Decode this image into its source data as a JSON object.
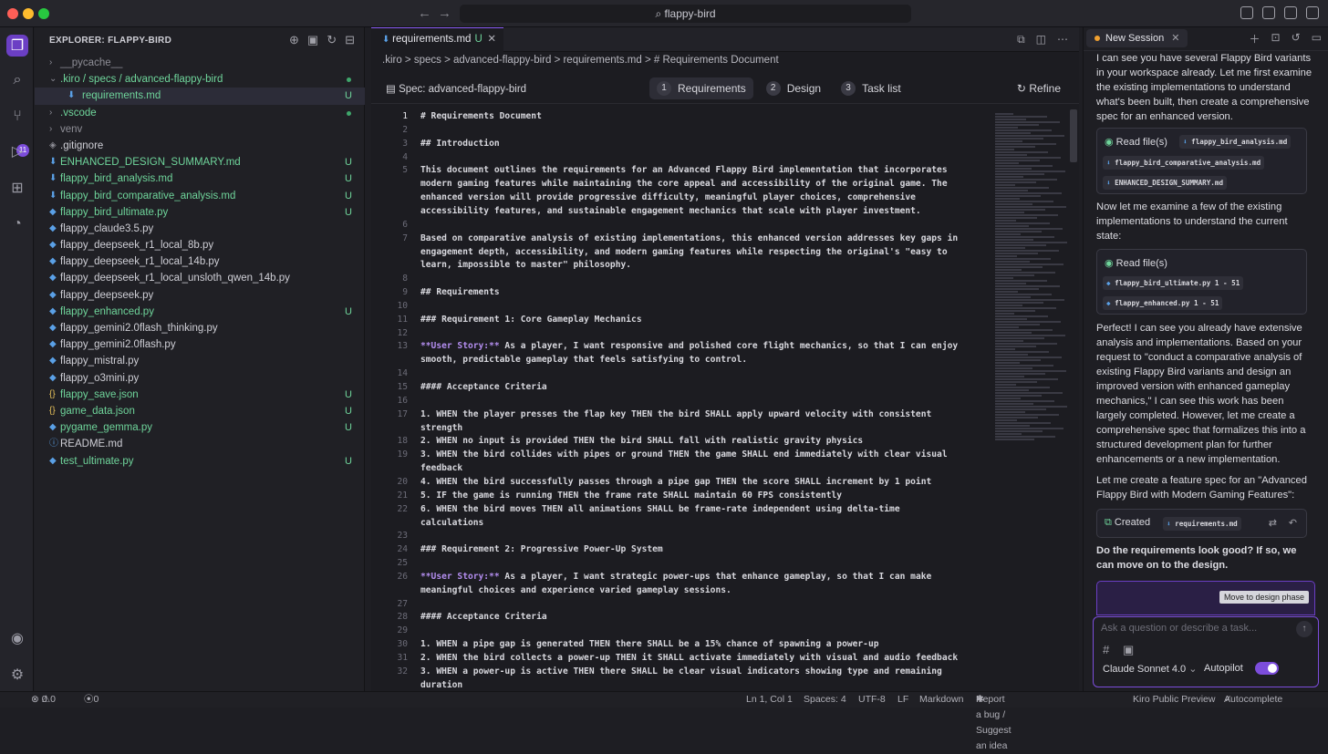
{
  "titlebar": {
    "search": "flappy-bird"
  },
  "explorer": {
    "title": "EXPLORER: FLAPPY-BIRD",
    "items": [
      {
        "name": "__pycache__",
        "chev": ">",
        "status": "",
        "color": "gray"
      },
      {
        "name": ".kiro / specs / advanced-flappy-bird",
        "chev": "v",
        "status": "dot",
        "color": "green"
      },
      {
        "name": "requirements.md",
        "status": "U",
        "color": "green"
      },
      {
        "name": ".vscode",
        "chev": ">",
        "status": "dot",
        "color": "green"
      },
      {
        "name": "venv",
        "chev": ">",
        "status": "",
        "color": "gray"
      },
      {
        "name": ".gitignore",
        "status": "",
        "color": "norm"
      },
      {
        "name": "ENHANCED_DESIGN_SUMMARY.md",
        "status": "U",
        "color": "green"
      },
      {
        "name": "flappy_bird_analysis.md",
        "status": "U",
        "color": "green"
      },
      {
        "name": "flappy_bird_comparative_analysis.md",
        "status": "U",
        "color": "green"
      },
      {
        "name": "flappy_bird_ultimate.py",
        "status": "U",
        "color": "green"
      },
      {
        "name": "flappy_claude3.5.py",
        "status": "",
        "color": "norm"
      },
      {
        "name": "flappy_deepseek_r1_local_8b.py",
        "status": "",
        "color": "norm"
      },
      {
        "name": "flappy_deepseek_r1_local_14b.py",
        "status": "",
        "color": "norm"
      },
      {
        "name": "flappy_deepseek_r1_local_unsloth_qwen_14b.py",
        "status": "",
        "color": "norm"
      },
      {
        "name": "flappy_deepseek.py",
        "status": "",
        "color": "norm"
      },
      {
        "name": "flappy_enhanced.py",
        "status": "U",
        "color": "green"
      },
      {
        "name": "flappy_gemini2.0flash_thinking.py",
        "status": "",
        "color": "norm"
      },
      {
        "name": "flappy_gemini2.0flash.py",
        "status": "",
        "color": "norm"
      },
      {
        "name": "flappy_mistral.py",
        "status": "",
        "color": "norm"
      },
      {
        "name": "flappy_o3mini.py",
        "status": "",
        "color": "norm"
      },
      {
        "name": "flappy_save.json",
        "status": "U",
        "color": "green"
      },
      {
        "name": "game_data.json",
        "status": "U",
        "color": "green"
      },
      {
        "name": "pygame_gemma.py",
        "status": "U",
        "color": "green"
      },
      {
        "name": "README.md",
        "status": "",
        "color": "norm"
      },
      {
        "name": "test_ultimate.py",
        "status": "U",
        "color": "green"
      }
    ]
  },
  "editor": {
    "tab_label": "requirements.md",
    "tab_status": "U",
    "breadcrumb": ".kiro  >  specs  >  advanced-flappy-bird  >  requirements.md  >  # Requirements Document",
    "spec_title": "Spec: advanced-flappy-bird",
    "steps": [
      {
        "n": "1",
        "label": "Requirements"
      },
      {
        "n": "2",
        "label": "Design"
      },
      {
        "n": "3",
        "label": "Task list"
      }
    ],
    "refine": "Refine",
    "lines": [
      {
        "num": "1",
        "text": "# Requirements Document"
      },
      {
        "num": "2",
        "text": ""
      },
      {
        "num": "3",
        "text": "## Introduction"
      },
      {
        "num": "4",
        "text": ""
      },
      {
        "num": "5",
        "text": "This document outlines the requirements for an Advanced Flappy Bird implementation that incorporates"
      },
      {
        "num": "",
        "text": "modern gaming features while maintaining the core appeal and accessibility of the original game. The"
      },
      {
        "num": "",
        "text": "enhanced version will provide progressive difficulty, meaningful player choices, comprehensive"
      },
      {
        "num": "",
        "text": "accessibility features, and sustainable engagement mechanics that scale with player investment."
      },
      {
        "num": "6",
        "text": ""
      },
      {
        "num": "7",
        "text": "Based on comparative analysis of existing implementations, this enhanced version addresses key gaps in"
      },
      {
        "num": "",
        "text": "engagement depth, accessibility, and modern gaming features while respecting the original's \"easy to"
      },
      {
        "num": "",
        "text": "learn, impossible to master\" philosophy."
      },
      {
        "num": "8",
        "text": ""
      },
      {
        "num": "9",
        "text": "## Requirements"
      },
      {
        "num": "10",
        "text": ""
      },
      {
        "num": "11",
        "text": "### Requirement 1: Core Gameplay Mechanics"
      },
      {
        "num": "12",
        "text": ""
      },
      {
        "num": "13",
        "us": "**User Story:**",
        "text": " As a player, I want responsive and polished core flight mechanics, so that I can enjoy"
      },
      {
        "num": "",
        "text": "smooth, predictable gameplay that feels satisfying to control."
      },
      {
        "num": "14",
        "text": ""
      },
      {
        "num": "15",
        "text": "#### Acceptance Criteria"
      },
      {
        "num": "16",
        "text": ""
      },
      {
        "num": "17",
        "text": "1. WHEN the player presses the flap key THEN the bird SHALL apply upward velocity with consistent"
      },
      {
        "num": "",
        "text": "strength"
      },
      {
        "num": "18",
        "text": "2. WHEN no input is provided THEN the bird SHALL fall with realistic gravity physics"
      },
      {
        "num": "19",
        "text": "3. WHEN the bird collides with pipes or ground THEN the game SHALL end immediately with clear visual"
      },
      {
        "num": "",
        "text": "feedback"
      },
      {
        "num": "20",
        "text": "4. WHEN the bird successfully passes through a pipe gap THEN the score SHALL increment by 1 point"
      },
      {
        "num": "21",
        "text": "5. IF the game is running THEN the frame rate SHALL maintain 60 FPS consistently"
      },
      {
        "num": "22",
        "text": "6. WHEN the bird moves THEN all animations SHALL be frame-rate independent using delta-time"
      },
      {
        "num": "",
        "text": "calculations"
      },
      {
        "num": "23",
        "text": ""
      },
      {
        "num": "24",
        "text": "### Requirement 2: Progressive Power-Up System"
      },
      {
        "num": "25",
        "text": ""
      },
      {
        "num": "26",
        "us": "**User Story:**",
        "text": " As a player, I want strategic power-ups that enhance gameplay, so that I can make"
      },
      {
        "num": "",
        "text": "meaningful choices and experience varied gameplay sessions."
      },
      {
        "num": "27",
        "text": ""
      },
      {
        "num": "28",
        "text": "#### Acceptance Criteria"
      },
      {
        "num": "29",
        "text": ""
      },
      {
        "num": "30",
        "text": "1. WHEN a pipe gap is generated THEN there SHALL be a 15% chance of spawning a power-up"
      },
      {
        "num": "31",
        "text": "2. WHEN the bird collects a power-up THEN it SHALL activate immediately with visual and audio feedback"
      },
      {
        "num": "32",
        "text": "3. WHEN a power-up is active THEN there SHALL be clear visual indicators showing type and remaining"
      },
      {
        "num": "",
        "text": "duration"
      }
    ]
  },
  "chat": {
    "session": "New Session",
    "msg1": "I can see you have several Flappy Bird variants in your workspace already. Let me first examine the existing implementations to understand what's been built, then create a comprehensive spec for an enhanced version.",
    "read1_label": "Read file(s)",
    "read1_files": [
      "flappy_bird_analysis.md",
      "flappy_bird_comparative_analysis.md",
      "ENHANCED_DESIGN_SUMMARY.md"
    ],
    "msg2": "Now let me examine a few of the existing implementations to understand the current state:",
    "read2_label": "Read file(s)",
    "read2_files": [
      "flappy_bird_ultimate.py 1 - 51",
      "flappy_enhanced.py 1 - 51"
    ],
    "msg3": "Perfect! I can see you already have extensive analysis and implementations. Based on your request to \"conduct a comparative analysis of existing Flappy Bird variants and design an improved version with enhanced gameplay mechanics,\" I can see this work has been largely completed. However, let me create a comprehensive spec that formalizes this into a structured development plan for further enhancements or a new implementation.",
    "msg4": "Let me create a feature spec for an \"Advanced Flappy Bird with Modern Gaming Features\":",
    "created_label": "Created",
    "created_file": "requirements.md",
    "question": "Do the requirements look good? If so, we can move on to the design.",
    "move_button": "Move to design phase",
    "input_placeholder": "Ask a question or describe a task...",
    "model": "Claude Sonnet 4.0",
    "autopilot": "Autopilot"
  },
  "status": {
    "problems": "0",
    "warnings": "0",
    "ports": "0",
    "position": "Ln 1, Col 1",
    "spaces": "Spaces: 4",
    "encoding": "UTF-8",
    "eol": "LF",
    "language": "Markdown",
    "report": "Report a bug / Suggest an idea",
    "preview": "Kiro Public Preview",
    "autocomplete": "Autocomplete"
  }
}
